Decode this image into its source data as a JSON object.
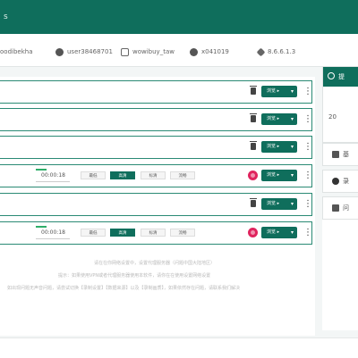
{
  "header": {
    "title": "s"
  },
  "accounts": [
    {
      "name": "oodibekha",
      "icon": "user-icon"
    },
    {
      "name": "user38468701",
      "icon": "user-circle-icon"
    },
    {
      "name": "wowibuy_taw",
      "icon": "square-icon"
    },
    {
      "name": "x041019",
      "icon": "user-icon"
    },
    {
      "name": "8.6.6.1.3",
      "icon": "gear-icon"
    }
  ],
  "rows": [
    {
      "browse": "浏览 ▸",
      "icon": "trash-icon"
    },
    {
      "browse": "浏览 ▸",
      "icon": "trash-icon"
    },
    {
      "browse": "浏览 ▸",
      "icon": "trash-icon"
    },
    {
      "browse": "浏览 ▸",
      "icon": "virus-icon",
      "timer": "00:00:18",
      "modes": [
        "最低",
        "高清",
        "标清",
        "流畅"
      ],
      "active_mode": 1
    },
    {
      "browse": "浏览 ▸",
      "icon": "trash-icon"
    },
    {
      "browse": "浏览 ▸",
      "icon": "virus-icon",
      "timer": "00:00:18",
      "modes": [
        "最低",
        "高清",
        "标清",
        "流畅"
      ],
      "active_mode": 1
    }
  ],
  "notices": [
    "请在在你网络设置中，设置代理服务器（问题中国大陆地区）",
    "提示：如果使用VPN或者代理服务器使用本软件，请你在在使用设置网络设置",
    "如出现问题无声音问题，请尝试切换【录制设置】【数据来源】以及【录制画质】，如果依然存在问题，请联系我们解决"
  ],
  "sidebar": {
    "title": "提",
    "number": "20",
    "items": [
      {
        "label": "基",
        "icon": "database-icon"
      },
      {
        "label": "录",
        "icon": "record-icon"
      },
      {
        "label": "问",
        "icon": "network-icon"
      }
    ]
  },
  "colors": {
    "accent": "#0f6e5c",
    "danger": "#e0245e"
  }
}
